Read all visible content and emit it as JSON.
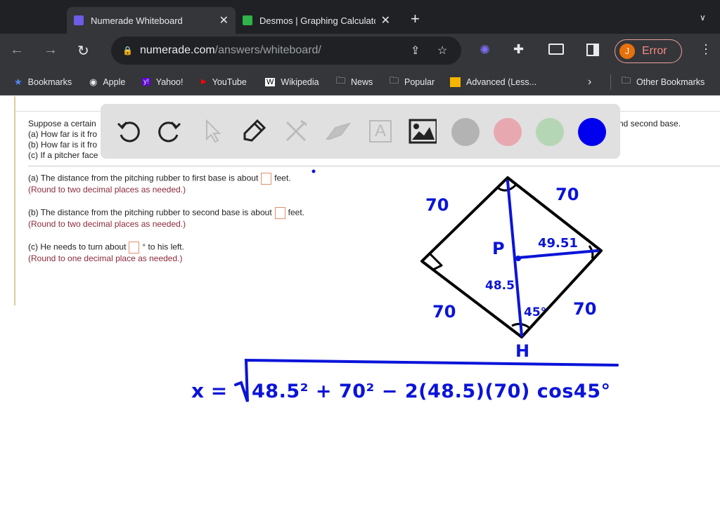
{
  "browser": {
    "tabs": [
      {
        "title": "Numerade Whiteboard",
        "active": true
      },
      {
        "title": "Desmos | Graphing Calculato",
        "active": false
      }
    ],
    "url_host": "numerade.com",
    "url_path": "/answers/whiteboard/",
    "profile_initial": "J",
    "profile_status": "Error",
    "bookmarks": [
      "Bookmarks",
      "Apple",
      "Yahoo!",
      "YouTube",
      "Wikipedia",
      "News",
      "Popular",
      "Advanced (Less...",
      "Other Bookmarks"
    ]
  },
  "question": {
    "intro_lines": [
      "Suppose a certain",
      "(a) How far is it fro",
      "(b) How far is it fro",
      "(c) If a pitcher face"
    ],
    "intro_tail": "nd second base.",
    "a_text": "(a) The distance from the pitching rubber to first base is about",
    "a_unit": "feet.",
    "a_hint": "(Round to two decimal places as needed.)",
    "b_text": "(b) The distance from the pitching rubber to second base is about",
    "b_unit": "feet.",
    "b_hint": "(Round to two decimal places as needed.)",
    "c_text": "(c) He needs to turn about",
    "c_unit": "° to his left.",
    "c_hint": "(Round to one decimal place as needed.)"
  },
  "whiteboard": {
    "tools": [
      "undo-icon",
      "redo-icon",
      "pointer-icon",
      "pencil-icon",
      "tools-icon",
      "eraser-icon",
      "text-icon",
      "image-icon"
    ],
    "colors": [
      "#b3b3b3",
      "#e8a8b0",
      "#b5d6b5",
      "#0000ee"
    ],
    "handwriting": {
      "side_labels": [
        "70",
        "70",
        "70",
        "70"
      ],
      "p_label": "P",
      "h_label": "H",
      "p_to_first": "49.51",
      "p_to_home": "48.5",
      "angle": "45°",
      "equation_lhs": "x =",
      "equation_rhs": "48.5² + 70² − 2(48.5)(70) cos45°"
    }
  }
}
